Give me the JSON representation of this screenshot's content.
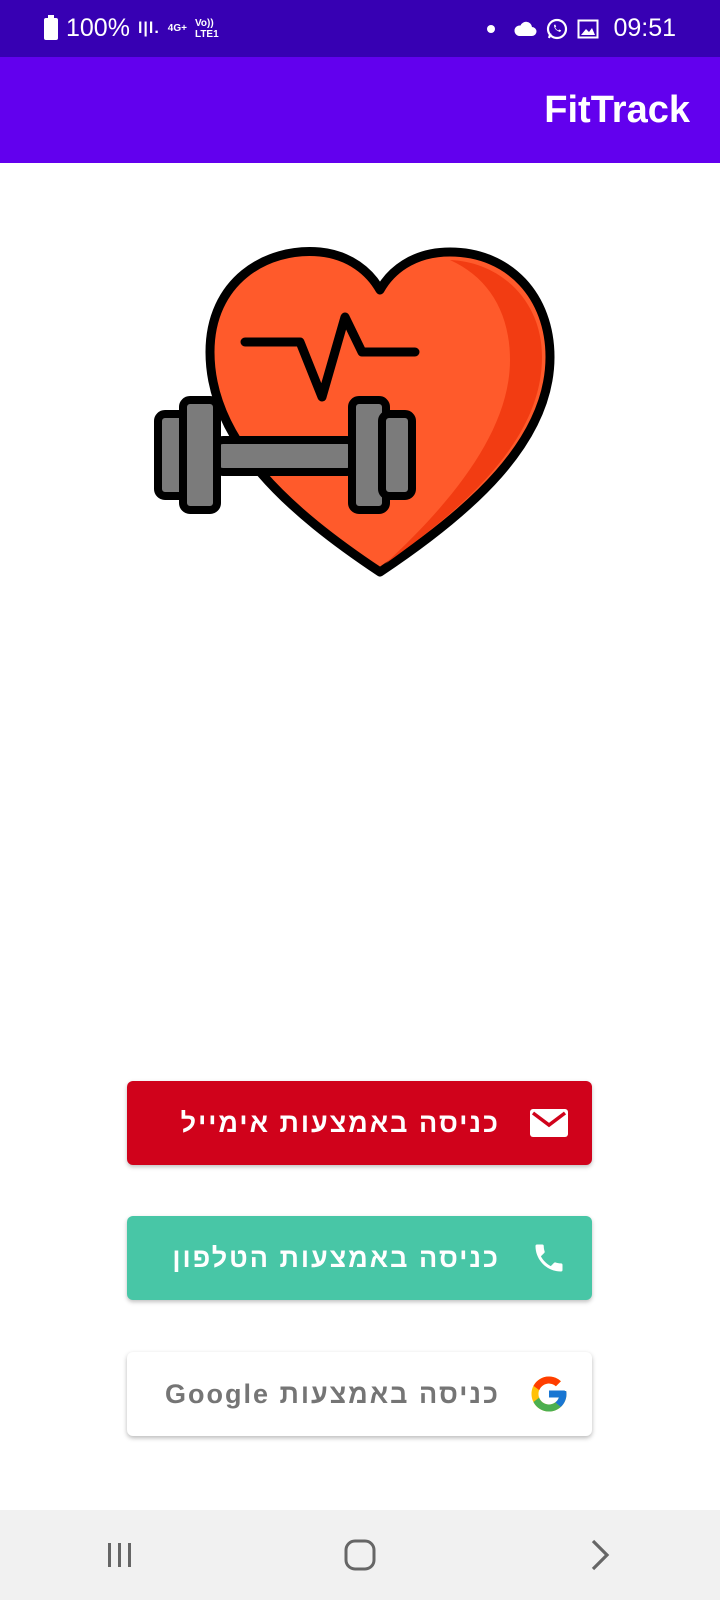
{
  "status_bar": {
    "battery": "100%",
    "network_top": "4G+",
    "network_bottom": "LTE1",
    "volte": "Vo))",
    "time": "09:51",
    "icons": [
      "battery-icon",
      "signal-icon",
      "dot-icon",
      "cloud-icon",
      "whatsapp-icon",
      "gallery-icon"
    ]
  },
  "app_bar": {
    "title": "FitTrack"
  },
  "logo": {
    "icon": "heart-dumbbell-icon",
    "colors": {
      "heart": "#ff5a2b",
      "heart_shade": "#f23c12",
      "dumbbell": "#7b7b7b",
      "outline": "#000000"
    }
  },
  "buttons": {
    "email": {
      "label": "כניסה באמצעות אימייל",
      "icon": "mail-icon",
      "color": "#d0021b"
    },
    "phone": {
      "label": "כניסה באמצעות הטלפון",
      "icon": "phone-icon",
      "color": "#48c6a6"
    },
    "google": {
      "label": "כניסה באמצעות Google",
      "icon": "google-icon",
      "color": "#ffffff"
    }
  },
  "nav_bar": {
    "items": [
      "recents-icon",
      "home-icon",
      "back-icon"
    ]
  }
}
